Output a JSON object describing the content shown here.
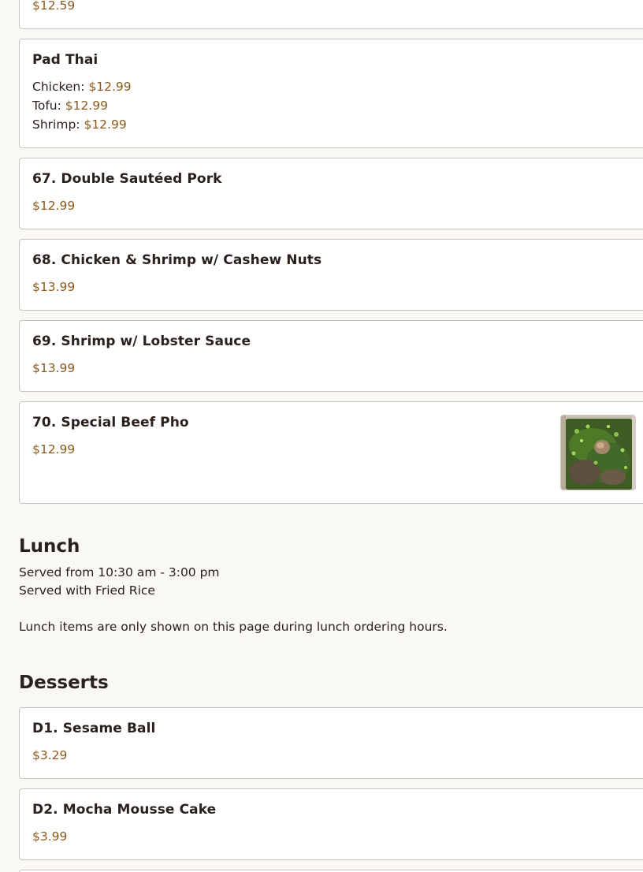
{
  "partial_card": {
    "price": "$12.59"
  },
  "pad_thai": {
    "name": "Pad Thai",
    "variants": [
      {
        "label": "Chicken:",
        "price": "$12.99"
      },
      {
        "label": "Tofu:",
        "price": "$12.99"
      },
      {
        "label": "Shrimp:",
        "price": "$12.99"
      }
    ]
  },
  "items": [
    {
      "name": "67. Double Sautéed Pork",
      "price": "$12.99"
    },
    {
      "name": "68. Chicken & Shrimp w/ Cashew Nuts",
      "price": "$13.99"
    },
    {
      "name": "69. Shrimp w/ Lobster Sauce",
      "price": "$13.99"
    },
    {
      "name": "70. Special Beef Pho",
      "price": "$12.99"
    }
  ],
  "lunch": {
    "title": "Lunch",
    "line1": "Served from 10:30 am - 3:00 pm",
    "line2": "Served with Fried Rice",
    "notice": "Lunch items are only shown on this page during lunch ordering hours."
  },
  "desserts": {
    "title": "Desserts",
    "items": [
      {
        "name": "D1. Sesame Ball",
        "price": "$3.29"
      },
      {
        "name": "D2. Mocha Mousse Cake",
        "price": "$3.99"
      }
    ]
  },
  "colors": {
    "price": "#8a5a1c",
    "text": "#2a211c",
    "border": "#c9c4bf",
    "background": "#faf8f5"
  }
}
